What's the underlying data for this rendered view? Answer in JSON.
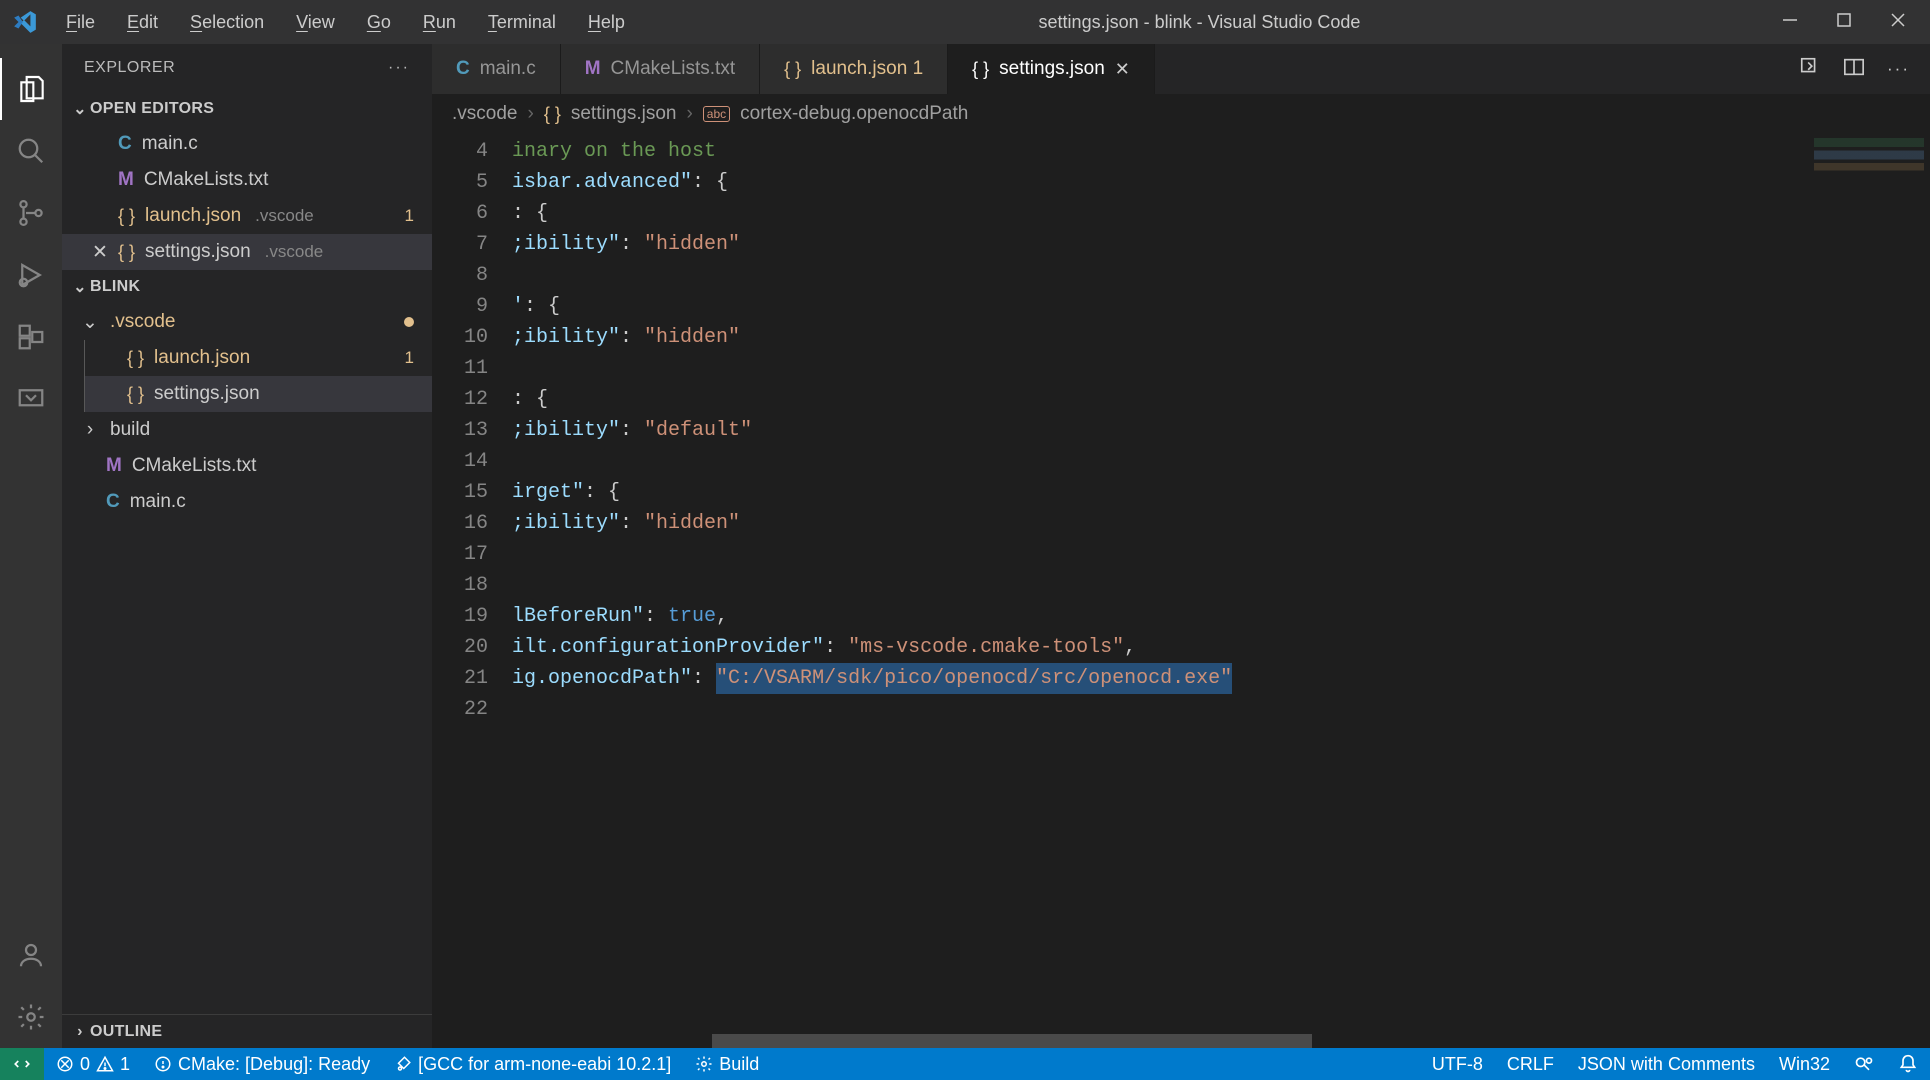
{
  "titlebar": {
    "menus": [
      "File",
      "Edit",
      "Selection",
      "View",
      "Go",
      "Run",
      "Terminal",
      "Help"
    ],
    "title": "settings.json - blink - Visual Studio Code"
  },
  "sidebar": {
    "header": "EXPLORER",
    "openEditors": {
      "label": "OPEN EDITORS",
      "items": [
        {
          "icon": "C",
          "name": "main.c",
          "desc": "",
          "close": false
        },
        {
          "icon": "M",
          "name": "CMakeLists.txt",
          "desc": "",
          "close": false
        },
        {
          "icon": "{}",
          "name": "launch.json",
          "desc": ".vscode",
          "badge": "1",
          "modified": true
        },
        {
          "icon": "{}",
          "name": "settings.json",
          "desc": ".vscode",
          "close": true,
          "selected": true
        }
      ]
    },
    "project": {
      "label": "BLINK",
      "tree": [
        {
          "type": "folder",
          "name": ".vscode",
          "expanded": true,
          "modified": true
        },
        {
          "type": "file",
          "icon": "{}",
          "name": "launch.json",
          "badge": "1",
          "depth": 2,
          "modified": true
        },
        {
          "type": "file",
          "icon": "{}",
          "name": "settings.json",
          "depth": 2,
          "selected": true
        },
        {
          "type": "folder",
          "name": "build",
          "expanded": false
        },
        {
          "type": "file",
          "icon": "M",
          "name": "CMakeLists.txt",
          "depth": 1
        },
        {
          "type": "file",
          "icon": "C",
          "name": "main.c",
          "depth": 1
        }
      ]
    },
    "outline": "OUTLINE"
  },
  "tabs": [
    {
      "icon": "C",
      "label": "main.c"
    },
    {
      "icon": "M",
      "label": "CMakeLists.txt"
    },
    {
      "icon": "{}",
      "label": "launch.json",
      "badge": "1",
      "modified": true
    },
    {
      "icon": "{}",
      "label": "settings.json",
      "active": true,
      "close": true
    }
  ],
  "breadcrumbs": {
    "parts": [
      ".vscode",
      "settings.json",
      "cortex-debug.openocdPath"
    ]
  },
  "editor": {
    "startLine": 4,
    "lines": [
      {
        "n": 4,
        "html": "<span class='s-comment'>inary on the host</span>"
      },
      {
        "n": 5,
        "html": "<span class='s-key'>isbar.advanced\"</span><span class='s-punc'>: {</span>"
      },
      {
        "n": 6,
        "html": "<span class='s-punc'>: {</span>"
      },
      {
        "n": 7,
        "html": "<span class='s-key'>;ibility\"</span><span class='s-punc'>: </span><span class='s-str'>\"hidden\"</span>"
      },
      {
        "n": 8,
        "html": ""
      },
      {
        "n": 9,
        "html": "<span class='s-key'>'</span><span class='s-punc'>: {</span>"
      },
      {
        "n": 10,
        "html": "<span class='s-key'>;ibility\"</span><span class='s-punc'>: </span><span class='s-str'>\"hidden\"</span>"
      },
      {
        "n": 11,
        "html": ""
      },
      {
        "n": 12,
        "html": "<span class='s-punc'>: {</span>"
      },
      {
        "n": 13,
        "html": "<span class='s-key'>;ibility\"</span><span class='s-punc'>: </span><span class='s-str'>\"default\"</span>"
      },
      {
        "n": 14,
        "html": ""
      },
      {
        "n": 15,
        "html": "<span class='s-key'>irget\"</span><span class='s-punc'>: {</span>"
      },
      {
        "n": 16,
        "html": "<span class='s-key'>;ibility\"</span><span class='s-punc'>: </span><span class='s-str'>\"hidden\"</span>"
      },
      {
        "n": 17,
        "html": ""
      },
      {
        "n": 18,
        "html": ""
      },
      {
        "n": 19,
        "html": "<span class='s-key'>lBeforeRun\"</span><span class='s-punc'>: </span><span class='s-bool'>true</span><span class='s-punc'>,</span>"
      },
      {
        "n": 20,
        "html": "<span class='s-key'>ilt.configurationProvider\"</span><span class='s-punc'>: </span><span class='s-str'>\"ms-vscode.cmake-tools\"</span><span class='s-punc'>,</span>"
      },
      {
        "n": 21,
        "html": "<span class='s-key'>ig.openocdPath\"</span><span class='s-punc'>: </span><span class='code-line selected s-str'>\"C:/VSARM/sdk/pico/openocd/src/openocd.exe\"</span>"
      },
      {
        "n": 22,
        "html": ""
      }
    ]
  },
  "statusbar": {
    "errors": "0",
    "warnings": "1",
    "cmake": "CMake: [Debug]: Ready",
    "kit": "[GCC for arm-none-eabi 10.2.1]",
    "build": "Build",
    "encoding": "UTF-8",
    "eol": "CRLF",
    "lang": "JSON with Comments",
    "platform": "Win32"
  }
}
